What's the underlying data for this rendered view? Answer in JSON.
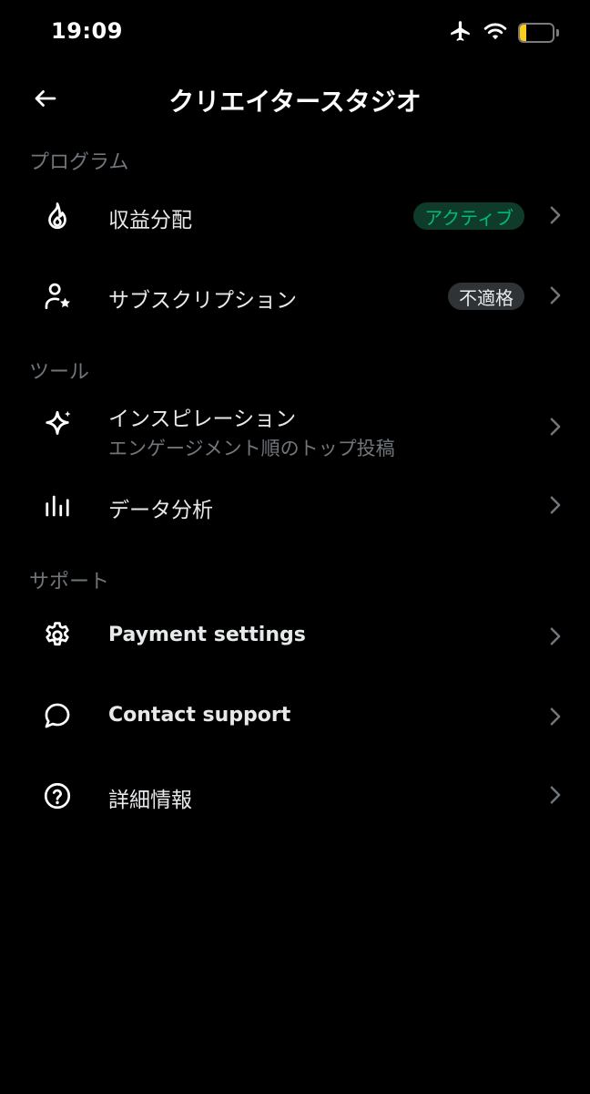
{
  "status_bar": {
    "time": "19:09",
    "battery_level": "20",
    "battery_fraction": 0.2,
    "icons": [
      "airplane-icon",
      "wifi-icon",
      "battery-icon"
    ]
  },
  "header": {
    "title": "クリエイタースタジオ",
    "back_icon": "arrow-left-icon"
  },
  "sections": {
    "program": {
      "title": "プログラム",
      "items": [
        {
          "label": "収益分配",
          "icon": "flame-icon",
          "badge": "アクティブ",
          "badge_color": "#00ba7c"
        },
        {
          "label": "サブスクリプション",
          "icon": "person-star-icon",
          "badge": "不適格"
        }
      ]
    },
    "tools": {
      "title": "ツール",
      "items": [
        {
          "label": "インスピレーション",
          "sub": "エンゲージメント順のトップ投稿",
          "icon": "sparkle-icon"
        },
        {
          "label": "データ分析",
          "icon": "bar-chart-icon"
        }
      ]
    },
    "support": {
      "title": "サポート",
      "items": [
        {
          "label": "Payment settings",
          "icon": "gear-icon"
        },
        {
          "label": "Contact support",
          "icon": "chat-bubble-icon"
        },
        {
          "label": "詳細情報",
          "icon": "help-circle-icon"
        }
      ]
    }
  },
  "colors": {
    "background": "#000000",
    "text_primary": "#e7e9ea",
    "text_secondary": "#71767b",
    "accent_green": "#00ba7c",
    "battery": "#f7ce1b"
  }
}
